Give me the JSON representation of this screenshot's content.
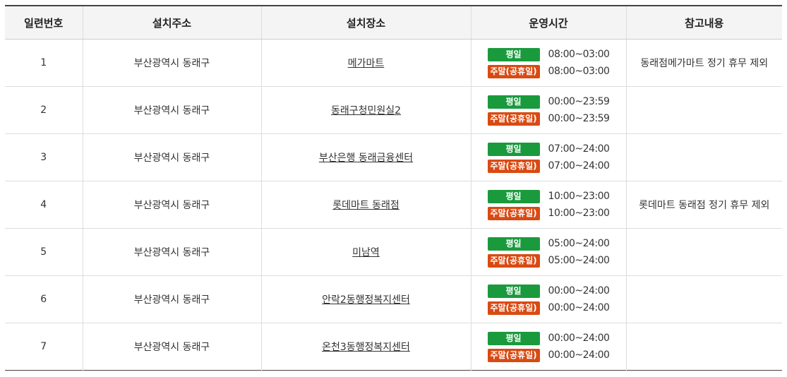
{
  "table": {
    "headers": [
      "일련번호",
      "설치주소",
      "설치장소",
      "운영시간",
      "참고내용"
    ],
    "badges": {
      "weekday": "평일",
      "weekend": "주말(공휴일)"
    },
    "colors": {
      "weekday_badge": "#1a9a3d",
      "weekend_badge": "#d94a12",
      "header_bg": "#f4f4f4"
    },
    "rows": [
      {
        "no": "1",
        "address": "부산광역시 동래구",
        "place": "메가마트",
        "weekday_hours": "08:00~03:00",
        "weekend_hours": "08:00~03:00",
        "note": "동래점메가마트 정기 휴무 제외"
      },
      {
        "no": "2",
        "address": "부산광역시 동래구",
        "place": "동래구청민원실2",
        "weekday_hours": "00:00~23:59",
        "weekend_hours": "00:00~23:59",
        "note": ""
      },
      {
        "no": "3",
        "address": "부산광역시 동래구",
        "place": "부산은행 동래금융센터",
        "weekday_hours": "07:00~24:00",
        "weekend_hours": "07:00~24:00",
        "note": ""
      },
      {
        "no": "4",
        "address": "부산광역시 동래구",
        "place": "롯데마트 동래점",
        "weekday_hours": "10:00~23:00",
        "weekend_hours": "10:00~23:00",
        "note": "롯데마트 동래점 정기 휴무 제외"
      },
      {
        "no": "5",
        "address": "부산광역시 동래구",
        "place": "미남역",
        "weekday_hours": "05:00~24:00",
        "weekend_hours": "05:00~24:00",
        "note": ""
      },
      {
        "no": "6",
        "address": "부산광역시 동래구",
        "place": "안락2동행정복지센터",
        "weekday_hours": "00:00~24:00",
        "weekend_hours": "00:00~24:00",
        "note": ""
      },
      {
        "no": "7",
        "address": "부산광역시 동래구",
        "place": "온천3동행정복지센터",
        "weekday_hours": "00:00~24:00",
        "weekend_hours": "00:00~24:00",
        "note": ""
      }
    ]
  }
}
